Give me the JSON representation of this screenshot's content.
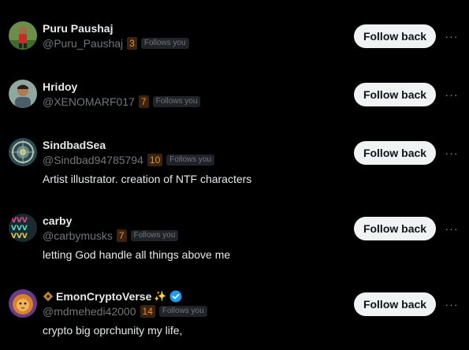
{
  "follow_back_label": "Follow back",
  "more_glyph": "···",
  "follows_you_label": "Follows you",
  "users": [
    {
      "name": "Puru Paushaj",
      "handle": "@Puru_Paushaj",
      "count": "3",
      "bio": "",
      "avatar": "soccer-player-avatar"
    },
    {
      "name": "Hridoy",
      "handle": "@XENOMARF017",
      "count": "7",
      "bio": "",
      "avatar": "portrait-avatar"
    },
    {
      "name": "SindbadSea",
      "handle": "@Sindbad94785794",
      "count": "10",
      "bio": "Artist illustrator. creation of NTF characters",
      "avatar": "ornament-avatar"
    },
    {
      "name": "carby",
      "handle": "@carbymusks",
      "count": "7",
      "bio": "letting God handle all things above me",
      "avatar": "pattern-avatar"
    },
    {
      "name": "EmonCryptoVerse",
      "handle": "@mdmehedi42000",
      "count": "14",
      "bio": "crypto big oprchunity my life,",
      "avatar": "lion-avatar",
      "name_prefix_icon": "diamond-icon",
      "name_suffix": "✨",
      "verified": true
    }
  ],
  "colors": {
    "background": "#000000",
    "button": "#eff3f4",
    "count_badge": "#f08a24",
    "verified": "#1d9bf0"
  }
}
